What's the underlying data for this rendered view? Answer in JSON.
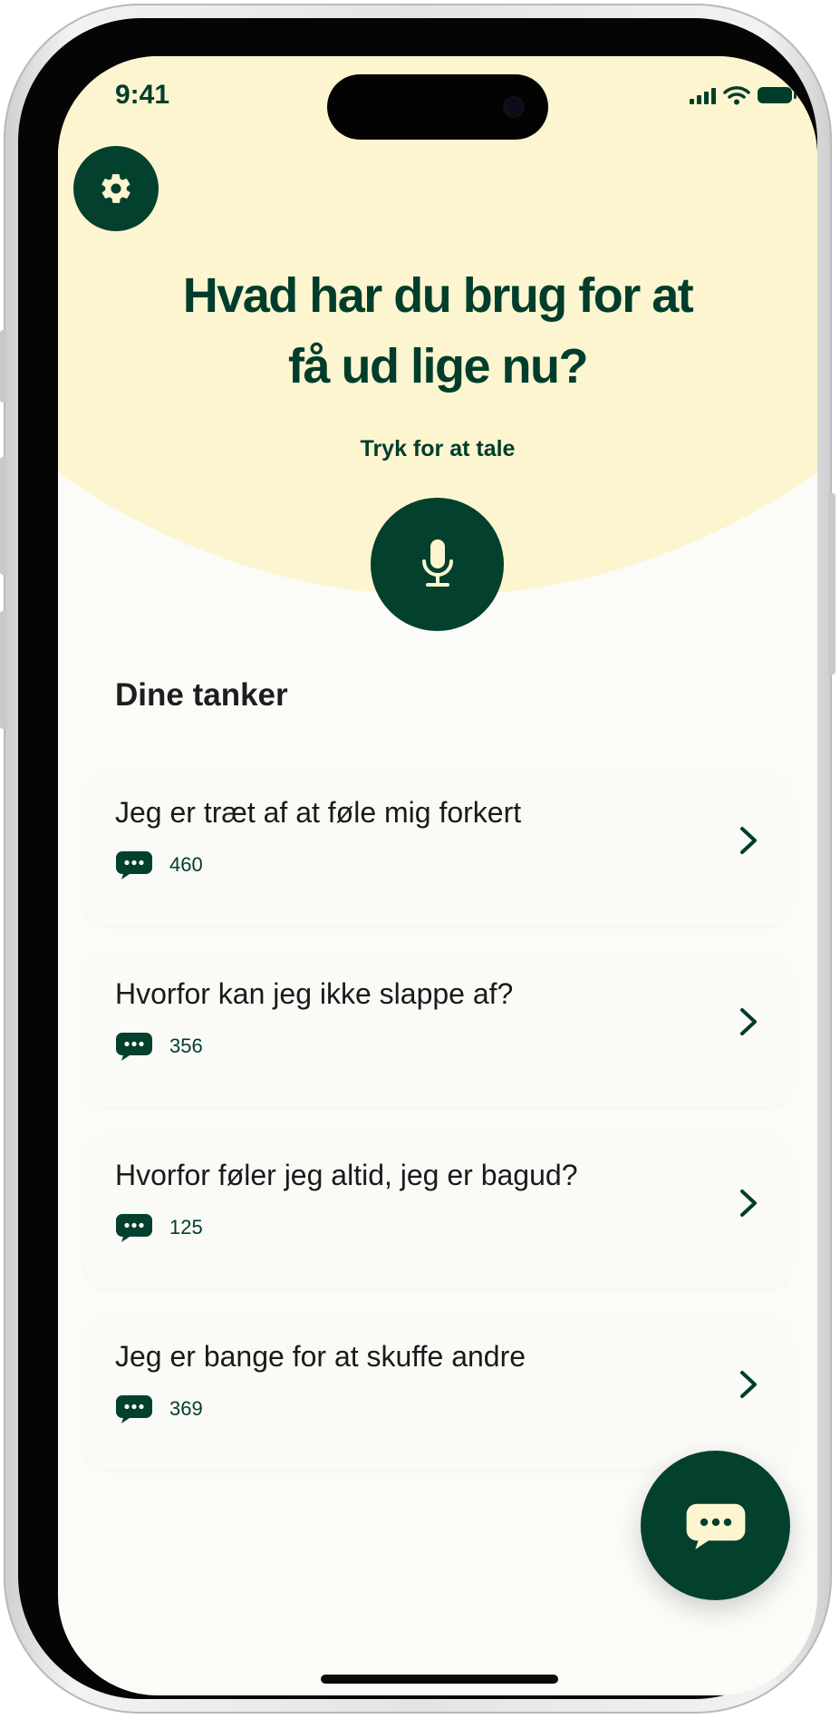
{
  "status_bar": {
    "time": "9:41"
  },
  "header": {
    "headline_line1": "Hvad har du brug for at",
    "headline_line2": "få ud lige nu?",
    "prompt": "Tryk for at tale"
  },
  "icons": {
    "settings": "gear-icon",
    "microphone": "microphone-icon",
    "comment": "chat-bubble-icon",
    "chevron": "chevron-right-icon",
    "fab": "chat-bubble-icon"
  },
  "colors": {
    "brand_green": "#03402e",
    "header_yellow": "#fcf5cf",
    "background": "#fbfbf8"
  },
  "thoughts": {
    "section_title": "Dine tanker",
    "items": [
      {
        "title": "Jeg er træt af at føle mig forkert",
        "count": "460"
      },
      {
        "title": "Hvorfor kan jeg ikke slappe af?",
        "count": "356"
      },
      {
        "title": "Hvorfor føler jeg altid, jeg er bagud?",
        "count": "125"
      },
      {
        "title": "Jeg er bange for at skuffe andre",
        "count": "369"
      }
    ]
  }
}
